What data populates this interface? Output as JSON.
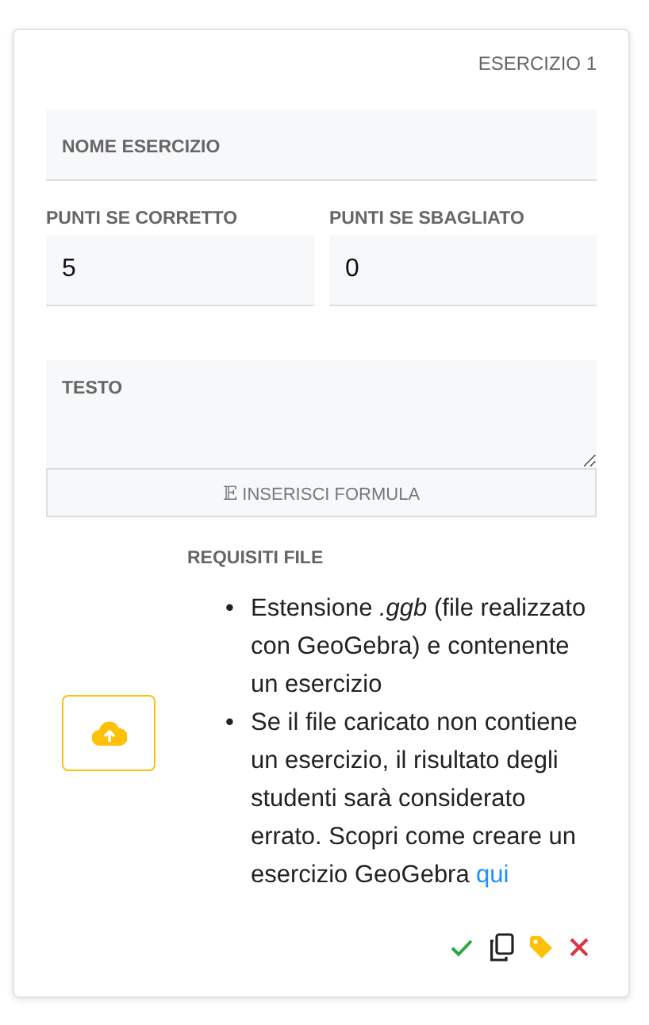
{
  "card": {
    "title": "ESERCIZIO 1"
  },
  "name_field": {
    "placeholder": "NOME ESERCIZIO"
  },
  "points": [
    {
      "label": "PUNTI SE CORRETTO",
      "value": "5"
    },
    {
      "label": "PUNTI SE SBAGLIATO",
      "value": "0"
    }
  ],
  "text_field": {
    "placeholder": "TESTO"
  },
  "formula_button": {
    "icon": "𝔼",
    "label": "INSERISCI FORMULA"
  },
  "requirements": {
    "title": "REQUISITI FILE",
    "items": [
      {
        "bullet": "•",
        "text": "Estensione *.ggb* (file realizzato con GeoGebra) e contenente un esercizio"
      },
      {
        "bullet": "•",
        "text": "Se il file caricato non contiene un esercizio, il risultato degli studenti sarà considerato errato. Scopri come creare un esercizio GeoGebra",
        "link": "qui"
      }
    ]
  },
  "actions": [
    {
      "kind": "check"
    },
    {
      "kind": "copy"
    },
    {
      "kind": "tag"
    },
    {
      "kind": "delete"
    }
  ]
}
